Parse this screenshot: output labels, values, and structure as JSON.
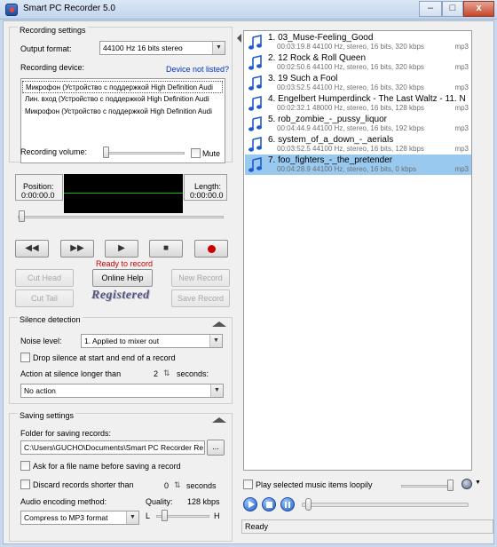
{
  "window": {
    "title": "Smart PC Recorder 5.0",
    "min_label": "–",
    "max_label": "□",
    "close_label": "x"
  },
  "recording": {
    "section_title": "Recording settings",
    "output_format_label": "Output format:",
    "output_format_value": "44100 Hz 16 bits stereo",
    "device_label": "Recording device:",
    "device_not_listed": "Device not listed?",
    "devices": [
      "Микрофон (Устройство с поддержкой High Definition Audi",
      "Лин. вход (Устройство с поддержкой High Definition Audi",
      "Микрофон (Устройство с поддержкой High Definition Audi"
    ],
    "volume_label": "Recording volume:",
    "mute_label": "Mute"
  },
  "position": {
    "label": "Position:",
    "value": "0:00:00.0"
  },
  "length": {
    "label": "Length:",
    "value": "0:00:00.0"
  },
  "transport": {
    "status": "Ready to record"
  },
  "actions": {
    "cut_head": "Cut Head",
    "online_help": "Online Help",
    "new_record": "New Record",
    "cut_tail": "Cut Tail",
    "registered": "Registered",
    "save_record": "Save Record"
  },
  "silence": {
    "title": "Silence detection",
    "noise_label": "Noise level:",
    "noise_value": "1. Applied to mixer out",
    "drop_label": "Drop silence at start and end of a record",
    "action_label": "Action at silence longer than",
    "seconds_value": "2",
    "seconds_label": "seconds:",
    "action_value": "No action"
  },
  "saving": {
    "title": "Saving settings",
    "folder_label": "Folder for saving records:",
    "folder_value": "C:\\Users\\GUCHO\\Documents\\Smart PC Recorder Re",
    "browse_label": "...",
    "ask_label": "Ask for a file name before saving a record",
    "discard_label": "Discard records shorter than",
    "discard_value": "0",
    "discard_unit": "seconds",
    "encoding_label": "Audio encoding method:",
    "encoding_value": "Compress to MP3 format",
    "quality_label": "Quality:",
    "quality_value": "128 kbps",
    "low_label": "L",
    "high_label": "H"
  },
  "playlist": {
    "items": [
      {
        "title": "1. 03_Muse-Feeling_Good",
        "meta": "00:03:19.8     44100 Hz, stereo, 16 bits, 320 kbps",
        "format": "mp3"
      },
      {
        "title": "2. 12 Rock & Roll Queen",
        "meta": "00:02:50.6     44100 Hz, stereo, 16 bits, 320 kbps",
        "format": "mp3"
      },
      {
        "title": "3. 19 Such a Fool",
        "meta": "00:03:52.5     44100 Hz, stereo, 16 bits, 320 kbps",
        "format": "mp3"
      },
      {
        "title": "4. Engelbert Humperdinck - The Last Waltz - 11. N",
        "meta": "00:02:32.1     48000 Hz, stereo, 16 bits, 128 kbps",
        "format": "mp3"
      },
      {
        "title": "5. rob_zombie_-_pussy_liquor",
        "meta": "00:04:44.9     44100 Hz, stereo, 16 bits, 192 kbps",
        "format": "mp3"
      },
      {
        "title": "6. system_of_a_down_-_aerials",
        "meta": "00:03:52.5     44100 Hz, stereo, 16 bits, 128 kbps",
        "format": "mp3"
      },
      {
        "title": "7. foo_fighters_-_the_pretender",
        "meta": "00:04:28.9     44100 Hz, stereo, 16 bits, 0 kbps",
        "format": "mp3"
      }
    ],
    "play_selected_label": "Play selected music items loopily"
  },
  "status": {
    "text": "Ready"
  },
  "colors": {
    "scope_bg": "#000000",
    "scope_line": "#00c000",
    "record_dot": "#cc0000",
    "status_text": "#cc0000",
    "selection": "#99c9ef"
  }
}
